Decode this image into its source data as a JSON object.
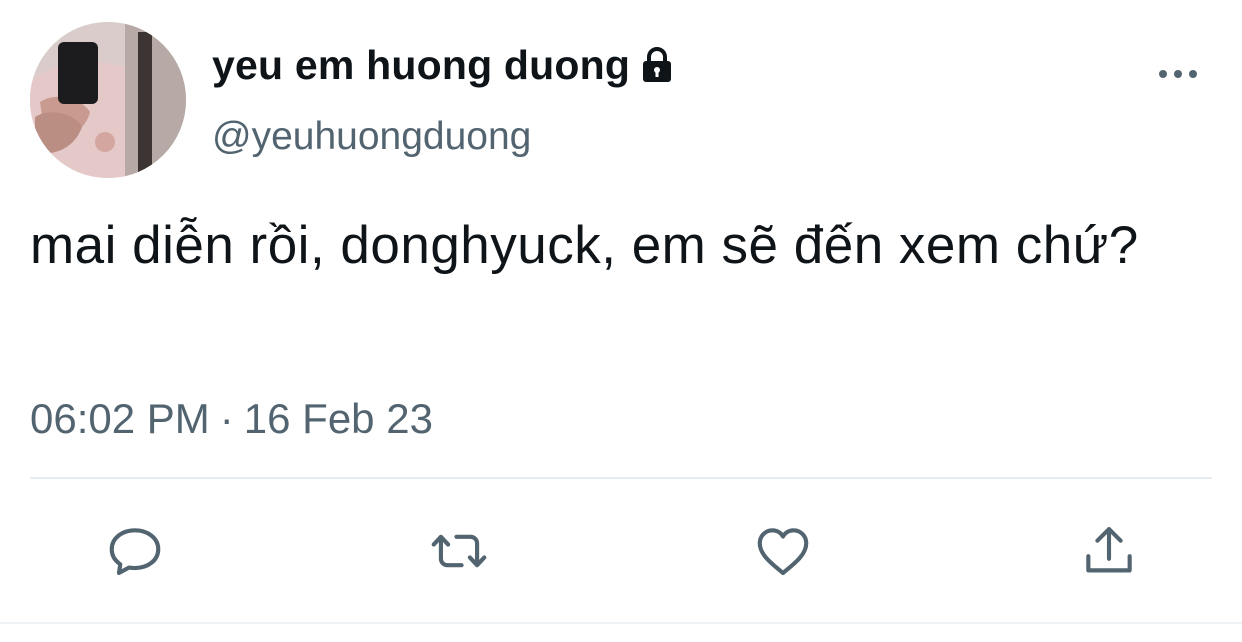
{
  "tweet": {
    "display_name": "yeu em huong duong",
    "handle": "@yeuhuongduong",
    "protected_icon": "lock-icon",
    "more_icon": "more-horizontal-icon",
    "text": "mai diễn rồi, donghyuck, em sẽ đến xem chứ?",
    "time": "06:02 PM",
    "separator": "·",
    "date": "16 Feb 23"
  },
  "actions": [
    {
      "name": "reply-button",
      "icon": "reply-icon"
    },
    {
      "name": "retweet-button",
      "icon": "retweet-icon"
    },
    {
      "name": "like-button",
      "icon": "heart-icon"
    },
    {
      "name": "share-button",
      "icon": "share-icon"
    }
  ],
  "colors": {
    "text_primary": "#0f1419",
    "text_secondary": "#536471",
    "divider": "#e6ecf0",
    "background": "#ffffff"
  }
}
